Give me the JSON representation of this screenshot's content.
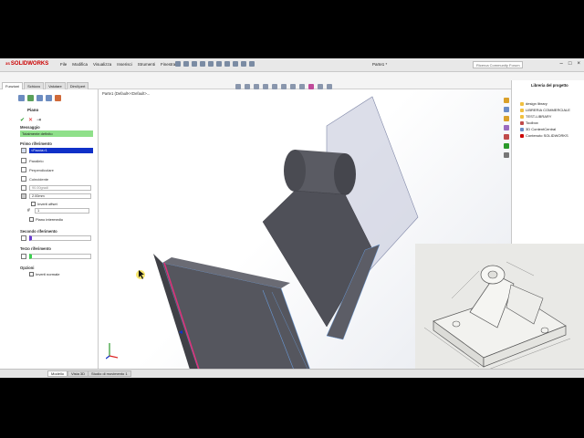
{
  "app": {
    "logo": "SOLIDWORKS",
    "logo_prefix": "3S",
    "document_title": "Parte1 *",
    "search_placeholder": "Ricerca Community Forum"
  },
  "menus": [
    "File",
    "Modifica",
    "Visualizza",
    "Inserisci",
    "Strumenti",
    "Finestra"
  ],
  "command_tabs": [
    {
      "label": "Funzioni",
      "active": true
    },
    {
      "label": "Schizzo",
      "active": false
    },
    {
      "label": "Valutare",
      "active": false
    },
    {
      "label": "DimXpert",
      "active": false
    }
  ],
  "breadcrumb": "Parte1 (Default<<Default>...",
  "property_manager": {
    "title": "Piano",
    "messaggio_label": "Messaggio",
    "message": "Totalmente definito",
    "primo_label": "Primo riferimento",
    "primo_selection": "<Faccia>1",
    "options": [
      "Parallelo",
      "Perpendicolare",
      "Coincidente"
    ],
    "angle_value": "90.00gradi",
    "distance_value": "2.00mm",
    "inverti_offset": "Inverti offset",
    "count_value": "1",
    "piano_intermedio": "Piano intermedio",
    "secondo_label": "Secondo riferimento",
    "terzo_label": "Terzo riferimento",
    "opzioni_label": "Opzioni",
    "inverti_normale": "Inverti normale"
  },
  "task_pane": {
    "title": "Libreria del progetto",
    "items": [
      "design library",
      "LIBRERIA COMMERCIALE",
      "TEST-LIBRARY",
      "Toolbox",
      "3D ContentCentral",
      "Contenuto SOLIDWORKS"
    ]
  },
  "bottom_tabs": [
    {
      "label": "Modello",
      "active": true
    },
    {
      "label": "Vista 3D",
      "active": false
    },
    {
      "label": "Studio di movimento 1",
      "active": false
    }
  ],
  "colors": {
    "accent": "#1030c8",
    "message_bg": "#8fe08a",
    "model_face": "#4f5058",
    "edge_highlight": "#e0307a",
    "plane": "#c9ccdd"
  }
}
